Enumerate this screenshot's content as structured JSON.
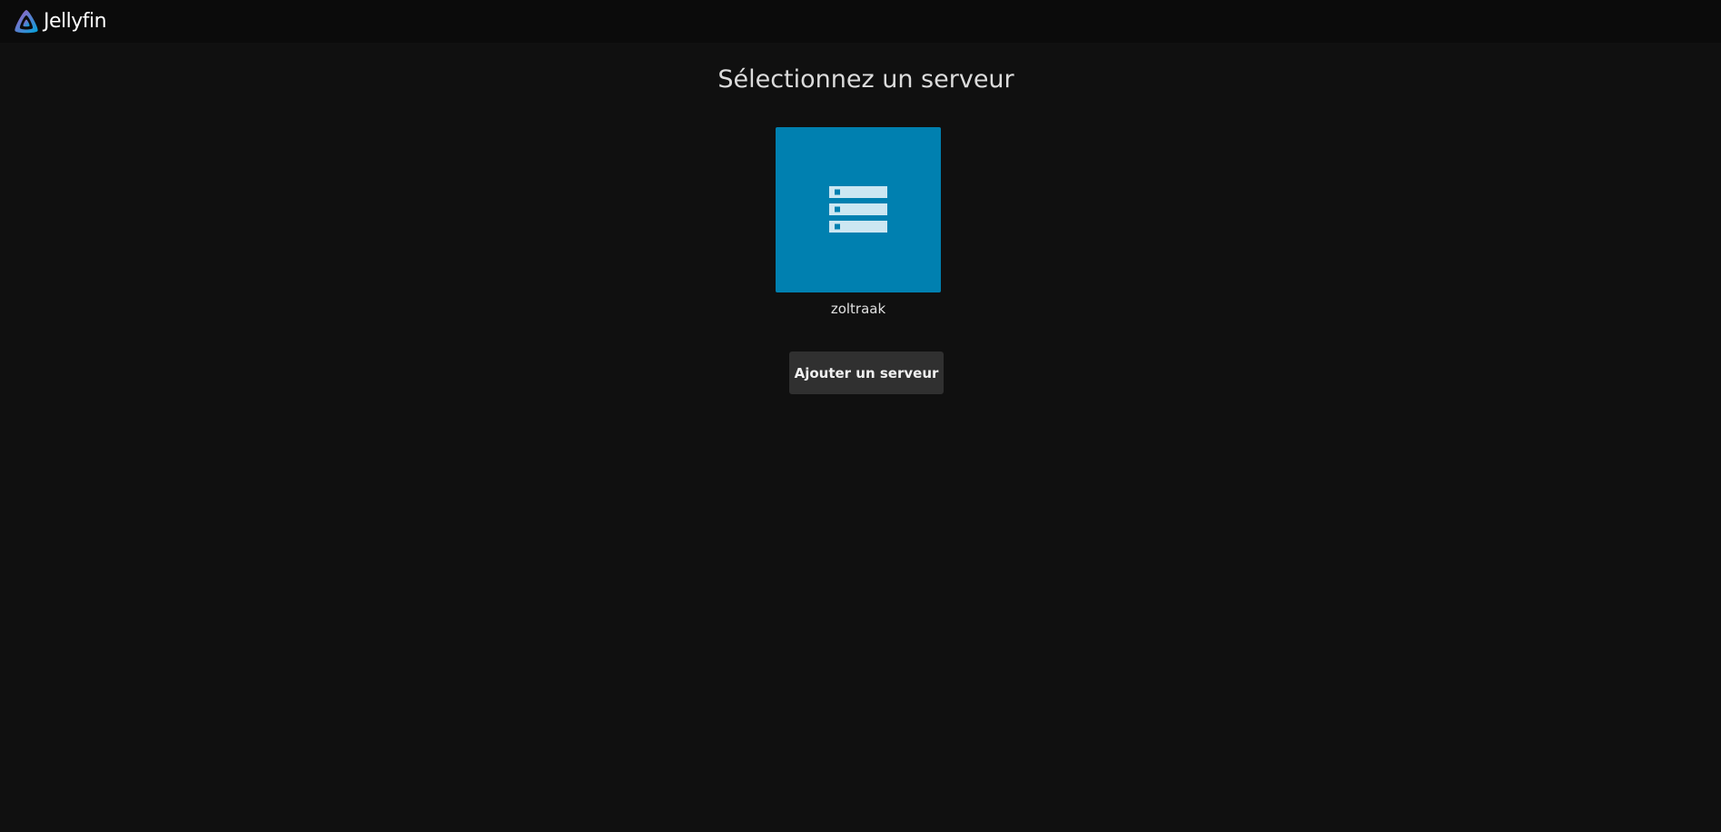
{
  "header": {
    "logo_text": "Jellyfin"
  },
  "page": {
    "title": "Sélectionnez un serveur"
  },
  "servers": [
    {
      "name": "zoltraak",
      "icon": "server-icon"
    }
  ],
  "actions": {
    "add_server_label": "Ajouter un serveur"
  },
  "colors": {
    "background": "#101010",
    "header_background": "#0b0b0b",
    "server_card": "#0080b0",
    "button_background": "#303030"
  }
}
